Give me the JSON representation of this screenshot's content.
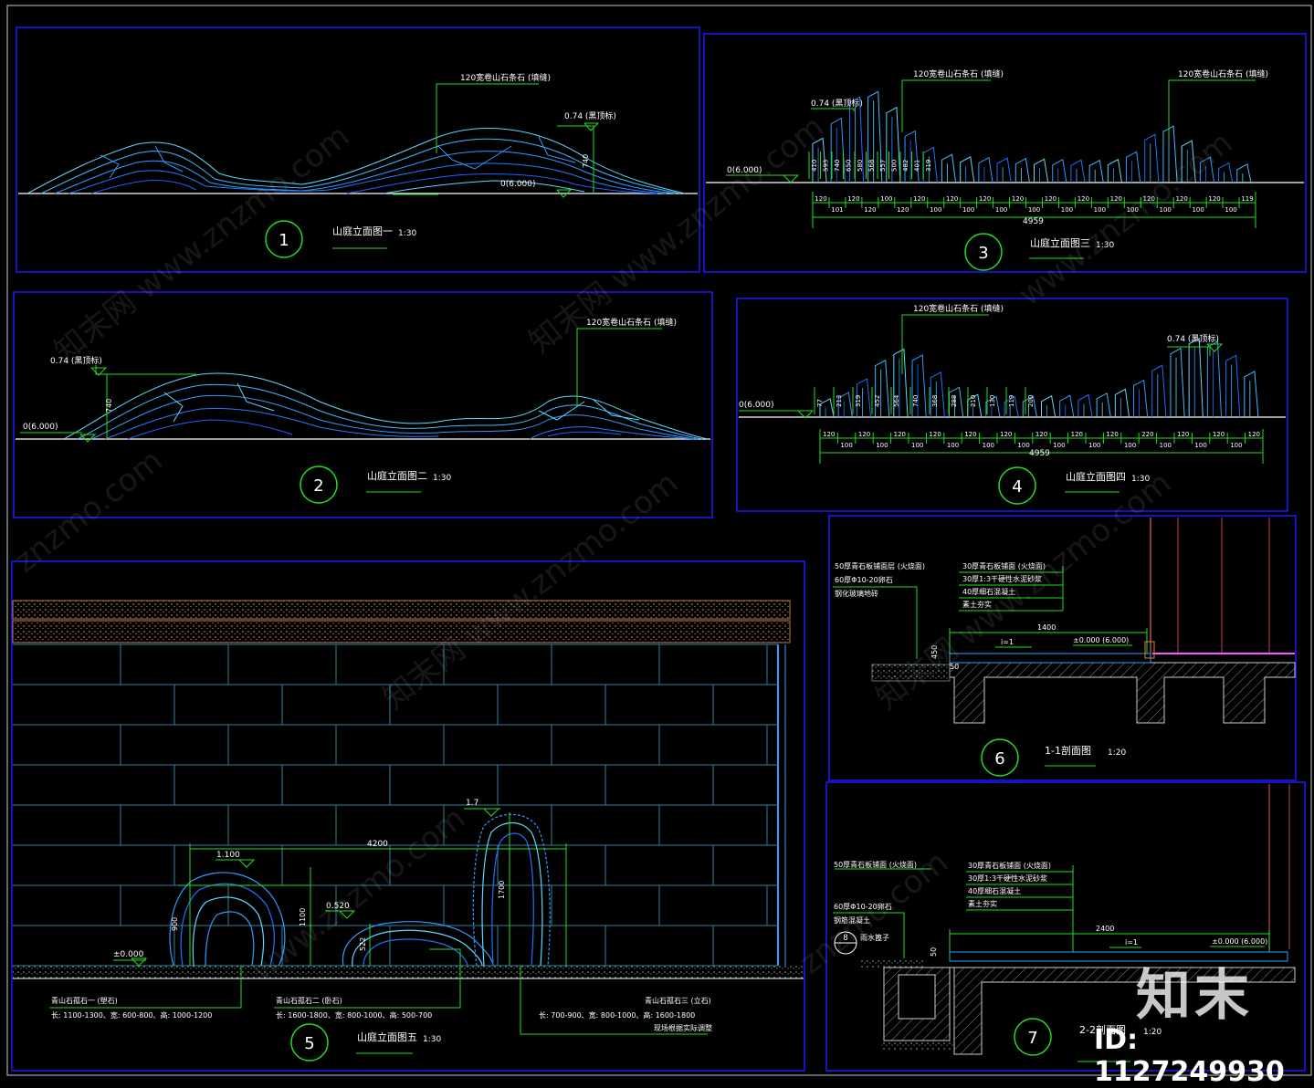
{
  "colors": {
    "frame": "#1a1aff",
    "leader": "#22dd22",
    "ground": "#ffffff",
    "stone_light": "#5fd8ff",
    "stone_mid": "#2f9bff",
    "stone_dark": "#1f5fff",
    "wall_line": "#2f7f9c",
    "text": "#ffffff",
    "earth": "#8a5a3a"
  },
  "views": {
    "v1": {
      "num": "1",
      "title": "山庭立面图一",
      "scale": "1:30",
      "callout_top": "120宽卷山石条石 (填缝)",
      "level_top": "0.74 (黑顶标)",
      "level_base": "0(6.000)",
      "dim_h": "740"
    },
    "v2": {
      "num": "2",
      "title": "山庭立面图二",
      "scale": "1:30",
      "callout_top": "120宽卷山石条石 (填缝)",
      "level_top": "0.74 (黑顶标)",
      "level_base": "0(6.000)",
      "dim_h": "740"
    },
    "v3": {
      "num": "3",
      "title": "山庭立面图三",
      "scale": "1:30",
      "callout_a": "120宽卷山石条石 (填缝)",
      "callout_b": "120宽卷山石条石 (填缝)",
      "level_top": "0.74 (黑顶标)",
      "level_base": "0(6.000)",
      "total": "4959",
      "dims_bottom": [
        "120",
        "101",
        "120",
        "120",
        "100",
        "120",
        "120",
        "100",
        "120",
        "100",
        "120",
        "100",
        "120",
        "100",
        "120",
        "100",
        "120",
        "100",
        "120",
        "100",
        "120",
        "100",
        "120",
        "100",
        "120",
        "100",
        "119"
      ],
      "heights": [
        "410",
        "593",
        "740",
        "650",
        "580",
        "568",
        "557",
        "500",
        "482",
        "401",
        "319"
      ]
    },
    "v4": {
      "num": "4",
      "title": "山庭立面图四",
      "scale": "1:30",
      "callout_a": "120宽卷山石条石 (填缝)",
      "level_top": "0.74 (黑顶标)",
      "level_base": "0(6.000)",
      "total": "4959",
      "dims_bottom": [
        "120",
        "100",
        "120",
        "100",
        "120",
        "100",
        "120",
        "100",
        "120",
        "100",
        "120",
        "100",
        "120",
        "100",
        "120",
        "100",
        "120",
        "100",
        "220",
        "100",
        "120",
        "100",
        "120",
        "100",
        "120"
      ],
      "heights": [
        "77",
        "213",
        "319",
        "452",
        "564",
        "740",
        "368",
        "288",
        "210",
        "130",
        "119",
        "200"
      ]
    },
    "v5": {
      "num": "5",
      "title": "山庭立面图五",
      "scale": "1:30",
      "dim_width": "4200",
      "level_a": "1.100",
      "level_b": "0.520",
      "level_c": "1.7",
      "level_base": "±0.000",
      "dim_1100": "1100",
      "dim_900": "900",
      "dim_522": "522",
      "dim_1700": "1700",
      "stone1": {
        "label": "青山石孤石一 (塑石)",
        "spec": "长: 1100-1300、宽: 600-800、高: 1000-1200"
      },
      "stone2": {
        "label": "青山石孤石二 (卧石)",
        "spec": "长: 1600-1800、宽: 800-1000、高: 500-700"
      },
      "stone3": {
        "label": "青山石孤石三 (立石)",
        "spec": "长: 700-900、宽: 800-1000、高: 1600-1800",
        "note": "现场根据实际调整"
      }
    },
    "v6": {
      "num": "6",
      "title": "1-1剖面图",
      "scale": "1:20",
      "left_labels": [
        "50厚青石板铺面层 (火烧面)",
        "60厚Φ10-20卵石",
        "钢化玻璃地砖"
      ],
      "right_labels": [
        "30厚青石板铺面 (火烧面)",
        "30厚1:3干硬性水泥砂浆",
        "40厚细石混凝土",
        "素土夯实"
      ],
      "dim_len": "1400",
      "slope": "i=1",
      "level": "±0.000 (6.000)",
      "dim_h": "450",
      "dim_50": "50"
    },
    "v7": {
      "num": "7",
      "title": "2-2剖面图",
      "scale": "1:20",
      "left_labels": [
        "50厚青石板铺面 (火烧面)",
        "60厚Φ10-20卵石",
        "钢筋混凝土"
      ],
      "right_labels": [
        "30厚青石板铺面 (火烧面)",
        "30厚1:3干硬性水泥砂浆",
        "40厚细石混凝土",
        "素土夯实"
      ],
      "detail_num": "8",
      "detail_label": "雨水篦子",
      "dim_len": "2400",
      "slope": "i=1",
      "level": "±0.000 (6.000)",
      "dim_50": "50"
    }
  },
  "watermarks": [
    "知末网 www.znzmo.com",
    "知末网 www.znzmo.com",
    "www.znzmo.com",
    "知末网 www.znzmo.com",
    "znzmo.com",
    "知末网 www.znzmo.com",
    "www.znzmo.com",
    "znzmo.com"
  ],
  "logo_text": "知末",
  "image_id": "ID: 1127249930"
}
